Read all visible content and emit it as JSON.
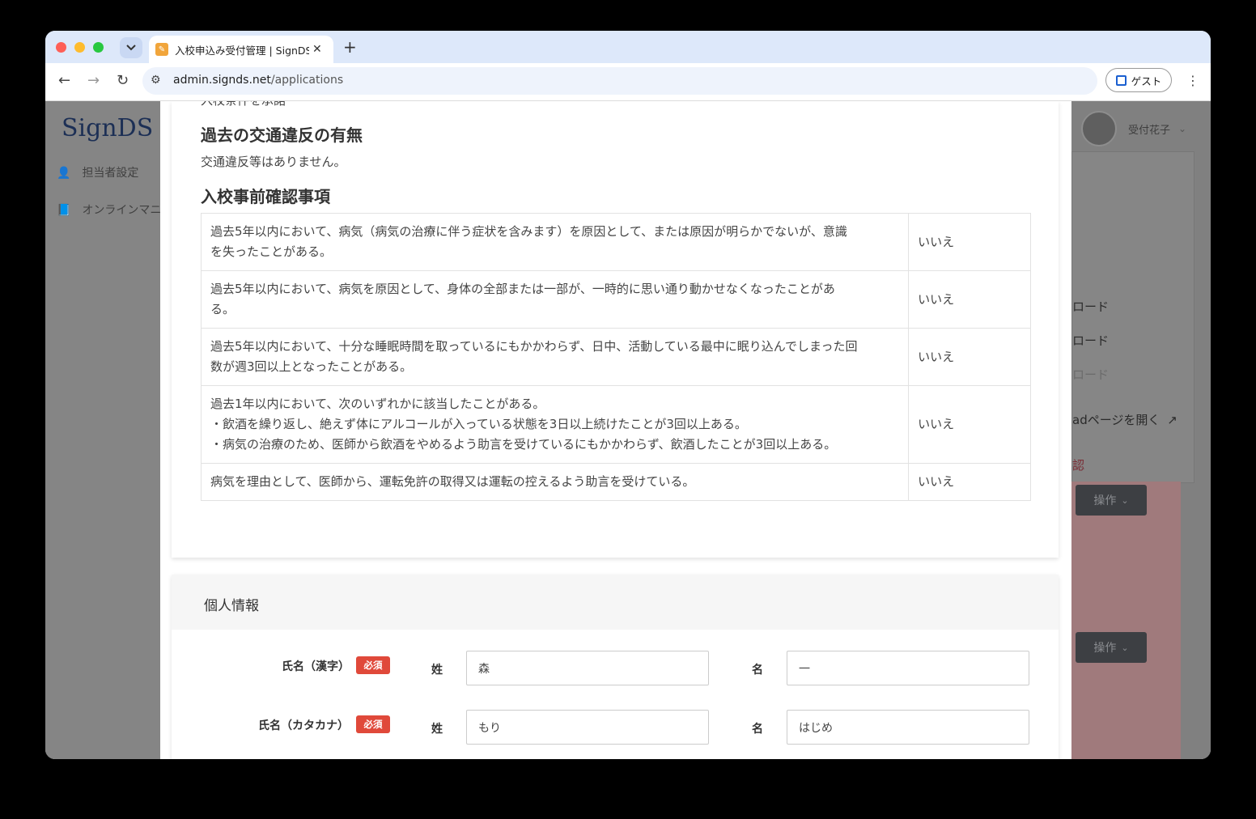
{
  "browser": {
    "tab_title": "入校申込み受付管理 | SignDS（",
    "tab_close": "✕",
    "new_tab": "+",
    "url_domain": "admin.signds.net",
    "url_path": "/applications",
    "guest_label": "ゲスト"
  },
  "background": {
    "logo": "SignDS",
    "nav": [
      "担当者設定",
      "オンラインマニ"
    ],
    "user_name": "受付花子",
    "dropdown_items": [
      "ロード",
      "ロード",
      "ロード",
      "adページを開く",
      "認"
    ],
    "operation_buttons": [
      "操作",
      "操作"
    ]
  },
  "section": {
    "cut_text": "入校条件を承諾",
    "violation_heading": "過去の交通違反の有無",
    "violation_text": "交通違反等はありません。",
    "checks_heading": "入校事前確認事項",
    "checks": [
      {
        "question": [
          "過去5年以内において、病気（病気の治療に伴う症状を含みます）を原因として、または原因が明らかでないが、意識",
          "を失ったことがある。"
        ],
        "answer": "いいえ"
      },
      {
        "question": [
          "過去5年以内において、病気を原因として、身体の全部または一部が、一時的に思い通り動かせなくなったことがあ",
          "る。"
        ],
        "answer": "いいえ"
      },
      {
        "question": [
          "過去5年以内において、十分な睡眠時間を取っているにもかかわらず、日中、活動している最中に眠り込んでしまった回",
          "数が週3回以上となったことがある。"
        ],
        "answer": "いいえ"
      },
      {
        "question": [
          "過去1年以内において、次のいずれかに該当したことがある。",
          "・飲酒を繰り返し、絶えず体にアルコールが入っている状態を3日以上続けたことが3回以上ある。",
          "・病気の治療のため、医師から飲酒をやめるよう助言を受けているにもかかわらず、飲酒したことが3回以上ある。"
        ],
        "answer": "いいえ"
      },
      {
        "question": [
          "病気を理由として、医師から、運転免許の取得又は運転の控えるよう助言を受けている。"
        ],
        "answer": "いいえ"
      }
    ]
  },
  "personal": {
    "title": "個人情報",
    "required_badge": "必須",
    "name_kanji": {
      "label": "氏名（漢字）",
      "sei_label": "姓",
      "sei_value": "森",
      "mei_label": "名",
      "mei_value": "一"
    },
    "name_kana": {
      "label": "氏名（カタカナ）",
      "sei_label": "姓",
      "sei_value": "もり",
      "mei_label": "名",
      "mei_value": "はじめ"
    }
  }
}
